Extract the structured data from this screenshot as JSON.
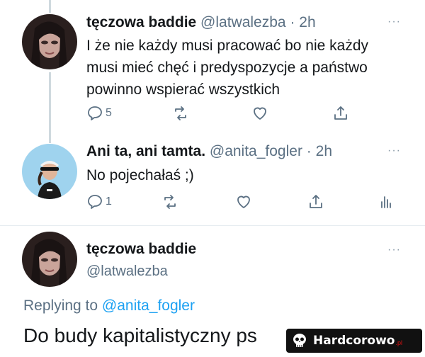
{
  "tweet1": {
    "display_name": "tęczowa baddie",
    "handle": "@latwalezba",
    "separator": "·",
    "time": "2h",
    "more": "···",
    "text_lines": [
      "I że nie każdy musi pracować bo nie każdy",
      "musi mieć chęć i predyspozycje a państwo",
      "powinno wspierać wszystkich"
    ],
    "reply_count": "5"
  },
  "tweet2": {
    "display_name": "Ani ta, ani tamta.",
    "handle": "@anita_fogler",
    "separator": "·",
    "time": "2h",
    "more": "···",
    "text": "No pojechałaś ;)",
    "reply_count": "1"
  },
  "main_tweet": {
    "display_name": "tęczowa baddie",
    "handle": "@latwalezba",
    "more": "···",
    "replying_prefix": "Replying to",
    "replying_to": "@anita_fogler",
    "text": "Do budy kapitalistyczny ps"
  },
  "watermark": {
    "brand": "Hardcorowo",
    "suffix": ".pl"
  },
  "colors": {
    "accent": "#1da1f2",
    "muted": "#5b7083",
    "thread_line": "#cfd9de"
  },
  "icons": [
    "reply-icon",
    "retweet-icon",
    "like-icon",
    "share-icon",
    "analytics-icon",
    "more-icon",
    "skull-icon"
  ]
}
